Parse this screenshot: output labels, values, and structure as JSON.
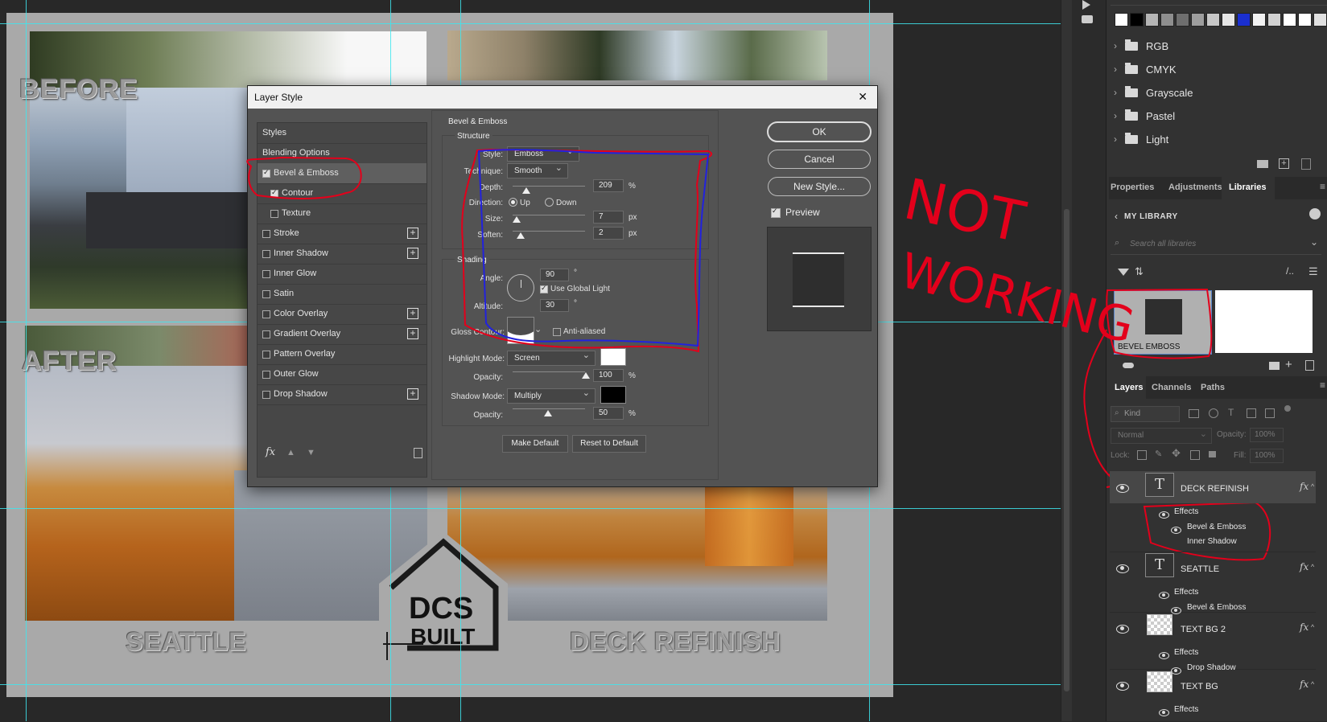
{
  "canvas": {
    "before_label": "BEFORE",
    "after_label": "AFTER",
    "seattle_label": "SEATTLE",
    "deck_label": "DECK REFINISH",
    "logo_line1": "DCS",
    "logo_line2": "BUILT"
  },
  "annotation": {
    "text_line1": "NOT",
    "text_line2": "WORKING"
  },
  "swatches": [
    "#ffffff",
    "#000000",
    "#b5b5b5",
    "#8e8e8e",
    "#6e6e6e",
    "#9e9e9e",
    "#c8c8c8",
    "#e6e6e6",
    "#1a2fd0",
    "#f2f2f2",
    "#d2d2d2",
    "#ffffff",
    "#ffffff",
    "#e0e0e0"
  ],
  "swatch_folders": [
    "RGB",
    "CMYK",
    "Grayscale",
    "Pastel",
    "Light"
  ],
  "panel_tabs": {
    "properties": "Properties",
    "adjustments": "Adjustments",
    "libraries": "Libraries"
  },
  "library": {
    "title": "MY LIBRARY",
    "search_placeholder": "Search all libraries",
    "item_label": "BEVEL EMBOSS"
  },
  "layers_tabs": {
    "layers": "Layers",
    "channels": "Channels",
    "paths": "Paths"
  },
  "layers_panel": {
    "kind_label": "Kind",
    "blend_mode": "Normal",
    "opacity_label": "Opacity:",
    "opacity_value": "100%",
    "lock_label": "Lock:",
    "fill_label": "Fill:",
    "fill_value": "100%",
    "fx": "fx",
    "effects": "Effects",
    "layers": [
      {
        "name": "DECK REFINISH",
        "effects": [
          "Bevel & Emboss",
          "Inner Shadow"
        ]
      },
      {
        "name": "SEATTLE",
        "effects": [
          "Bevel & Emboss"
        ]
      },
      {
        "name": "TEXT BG 2",
        "effects": [
          "Drop Shadow"
        ]
      },
      {
        "name": "TEXT BG",
        "effects": []
      }
    ]
  },
  "dialog": {
    "title": "Layer Style",
    "close": "✕",
    "sidebar": {
      "styles": "Styles",
      "blending": "Blending Options",
      "items": [
        {
          "label": "Bevel & Emboss",
          "checked": true,
          "plus": false
        },
        {
          "label": "Contour",
          "checked": true,
          "plus": false
        },
        {
          "label": "Texture",
          "checked": false,
          "plus": false
        },
        {
          "label": "Stroke",
          "checked": false,
          "plus": true
        },
        {
          "label": "Inner Shadow",
          "checked": false,
          "plus": true
        },
        {
          "label": "Inner Glow",
          "checked": false,
          "plus": false
        },
        {
          "label": "Satin",
          "checked": false,
          "plus": false
        },
        {
          "label": "Color Overlay",
          "checked": false,
          "plus": true
        },
        {
          "label": "Gradient Overlay",
          "checked": false,
          "plus": true
        },
        {
          "label": "Pattern Overlay",
          "checked": false,
          "plus": false
        },
        {
          "label": "Outer Glow",
          "checked": false,
          "plus": false
        },
        {
          "label": "Drop Shadow",
          "checked": false,
          "plus": true
        }
      ],
      "fx": "fx"
    },
    "bevel": {
      "section_title": "Bevel & Emboss",
      "structure_title": "Structure",
      "style_label": "Style:",
      "style_value": "Emboss",
      "technique_label": "Technique:",
      "technique_value": "Smooth",
      "depth_label": "Depth:",
      "depth_value": "209",
      "depth_unit": "%",
      "direction_label": "Direction:",
      "direction_up": "Up",
      "direction_down": "Down",
      "size_label": "Size:",
      "size_value": "7",
      "size_unit": "px",
      "soften_label": "Soften:",
      "soften_value": "2",
      "soften_unit": "px",
      "shading_title": "Shading",
      "angle_label": "Angle:",
      "angle_value": "90",
      "angle_unit": "°",
      "global_light_label": "Use Global Light",
      "altitude_label": "Altitude:",
      "altitude_value": "30",
      "altitude_unit": "°",
      "gloss_label": "Gloss Contour:",
      "anti_aliased_label": "Anti-aliased",
      "highlight_mode_label": "Highlight Mode:",
      "highlight_mode_value": "Screen",
      "highlight_opacity_label": "Opacity:",
      "highlight_opacity_value": "100",
      "highlight_opacity_unit": "%",
      "shadow_mode_label": "Shadow Mode:",
      "shadow_mode_value": "Multiply",
      "shadow_opacity_label": "Opacity:",
      "shadow_opacity_value": "50",
      "shadow_opacity_unit": "%",
      "make_default": "Make Default",
      "reset_default": "Reset to Default"
    },
    "buttons": {
      "ok": "OK",
      "cancel": "Cancel",
      "new_style": "New Style...",
      "preview": "Preview"
    }
  }
}
